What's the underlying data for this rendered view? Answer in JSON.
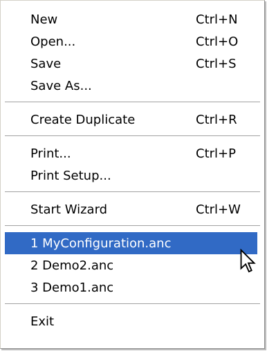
{
  "menu": {
    "items": [
      {
        "label": "New",
        "shortcut": "Ctrl+N"
      },
      {
        "label": "Open...",
        "shortcut": "Ctrl+O"
      },
      {
        "label": "Save",
        "shortcut": "Ctrl+S"
      },
      {
        "label": "Save As...",
        "shortcut": ""
      },
      {
        "label": "Create Duplicate",
        "shortcut": "Ctrl+R"
      },
      {
        "label": "Print...",
        "shortcut": "Ctrl+P"
      },
      {
        "label": "Print Setup...",
        "shortcut": ""
      },
      {
        "label": "Start Wizard",
        "shortcut": "Ctrl+W"
      },
      {
        "label": "1 MyConfiguration.anc",
        "shortcut": ""
      },
      {
        "label": "2 Demo2.anc",
        "shortcut": ""
      },
      {
        "label": "3 Demo1.anc",
        "shortcut": ""
      },
      {
        "label": "Exit",
        "shortcut": ""
      }
    ]
  },
  "colors": {
    "highlight": "#316ac5",
    "highlight_text": "#ffffff",
    "text": "#000000",
    "separator": "#a0a0a0"
  },
  "cursor": {
    "icon": "arrow-pointer-icon"
  }
}
